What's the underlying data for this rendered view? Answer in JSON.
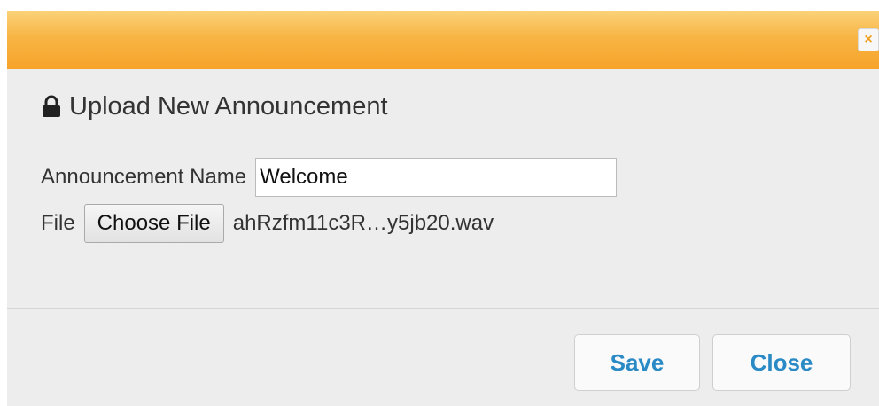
{
  "dialog": {
    "close_glyph": "×",
    "title": "Upload New Announcement",
    "title_icon": "lock-icon"
  },
  "form": {
    "name_label": "Announcement Name",
    "name_value": "Welcome",
    "file_label": "File",
    "choose_file_label": "Choose File",
    "file_name": "ahRzfm11c3R…y5jb20.wav"
  },
  "footer": {
    "save_label": "Save",
    "close_label": "Close"
  },
  "colors": {
    "titlebar_accent": "#f6a32a",
    "button_text": "#2a8ac6",
    "background": "#ededed"
  }
}
